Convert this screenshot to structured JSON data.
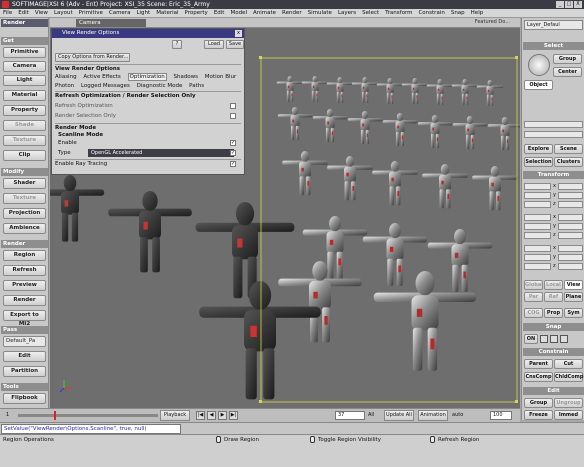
{
  "window": {
    "title": "SOFTIMAGE|XSI 6 (Adv - Ent) Project: XSI_35   Scene: Eric_35_Army",
    "controls": [
      "_",
      "□",
      "X"
    ]
  },
  "menubar": [
    "File",
    "Edit",
    "View",
    "Layout",
    "Primitive",
    "Camera",
    "Light",
    "Material",
    "Property",
    "Edit",
    "Model",
    "Animate",
    "Render",
    "Simulate",
    "Layers",
    "Select",
    "Transform",
    "Constrain",
    "Snap",
    "Help"
  ],
  "left_panel": {
    "tab": "Render",
    "sections": [
      {
        "title": "Get",
        "buttons": [
          "Primitive",
          "Camera",
          "Light",
          "Material",
          "Property",
          "Shade",
          "Texture",
          "Clip"
        ]
      },
      {
        "title": "Modify",
        "buttons": [
          "Shader",
          "Texture",
          "Projection",
          "Ambience"
        ]
      },
      {
        "title": "Render",
        "buttons": [
          "Region",
          "Refresh",
          "Preview",
          "Render",
          "Export to MI2"
        ]
      },
      {
        "title": "Pass",
        "buttons": [
          "Default_Pa",
          "Edit",
          "Partition"
        ]
      },
      {
        "title": "Tools",
        "buttons": [
          "Flipbook"
        ]
      }
    ]
  },
  "viewport": {
    "camera": "Camera",
    "featured": "Featured Do...",
    "flags": [
      "",
      "",
      ""
    ]
  },
  "dialog": {
    "title": "View Render Options",
    "toolbar": {
      "load": "Load",
      "save": "Save"
    },
    "copy_options": "Copy Options from Render...",
    "section": "View Render Options",
    "tabs_row1": [
      "Aliasing",
      "Active Effects",
      "Optimization",
      "Shadows",
      "Motion Blur"
    ],
    "tabs_row2": [
      "Photon",
      "Logged Messages",
      "Diagnostic Mode",
      "Paths"
    ],
    "active_tab": "Optimization",
    "group_title": "Refresh Optimization / Render Selection Only",
    "rows": [
      "Refresh Optimization",
      "Render Selection Only"
    ],
    "render_mode": {
      "title": "Render Mode",
      "sub": "Scanline Mode",
      "enable": "Enable",
      "type_label": "Type",
      "type_value": "OpenGL Accelerated"
    },
    "ray_tracing": "Enable Ray Tracing"
  },
  "right_panel": {
    "layer": "Layer_Defaul",
    "sections": {
      "select": "Select",
      "transform": "Transform",
      "snap": "Snap",
      "constrain": "Constrain",
      "edit": "Edit"
    },
    "select_buttons": [
      "Group",
      "Center",
      "Object"
    ],
    "explore": [
      "Explore",
      "Scene",
      "Selection",
      "Clusters"
    ],
    "axes": [
      "x",
      "y",
      "z"
    ],
    "transform_rows": [
      "s",
      "r",
      "t"
    ],
    "modes": [
      "Global",
      "Local",
      "View",
      "Par",
      "Ref",
      "Plane"
    ],
    "cog": [
      "COG",
      "Prop",
      "Sym"
    ],
    "snap": [
      "ON"
    ],
    "constrain": [
      "Parent",
      "Cut",
      "CnsComp",
      "ChldComp"
    ],
    "edit": [
      "Group",
      "Ungroup",
      "Freeze",
      "Immed"
    ]
  },
  "timeline": {
    "frame": "37",
    "start": "1",
    "end": "100",
    "playback": "Playback",
    "all": "All",
    "update": "Update All",
    "animation": "Animation",
    "auto": "auto"
  },
  "command_line": "SetValue(\"ViewRender\\Options.Scanline\", true, null)",
  "status": [
    "Region Operations",
    "Draw Region",
    "Toggle Region Visibility",
    "Refresh Region"
  ]
}
